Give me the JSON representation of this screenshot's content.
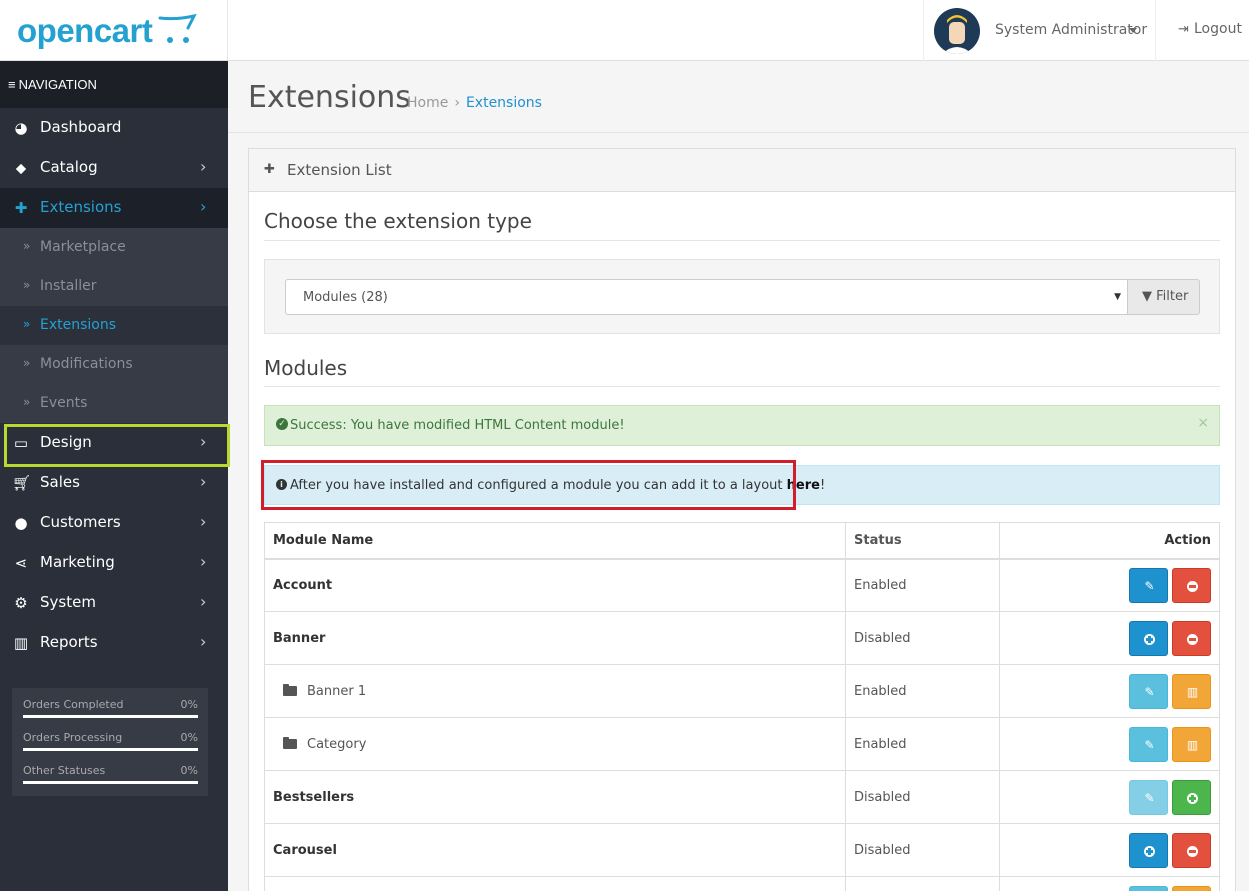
{
  "header": {
    "logo_text": "opencart",
    "user_name": "System Administrator",
    "logout_label": "Logout"
  },
  "sidebar": {
    "nav_header": "NAVIGATION",
    "items": [
      {
        "label": "Dashboard",
        "icon": "dashboard-icon"
      },
      {
        "label": "Catalog",
        "icon": "tags-icon"
      },
      {
        "label": "Extensions",
        "icon": "puzzle-icon",
        "active": true
      },
      {
        "label": "Design",
        "icon": "monitor-icon",
        "highlighted": true
      },
      {
        "label": "Sales",
        "icon": "cart-icon"
      },
      {
        "label": "Customers",
        "icon": "user-icon"
      },
      {
        "label": "Marketing",
        "icon": "share-icon"
      },
      {
        "label": "System",
        "icon": "gear-icon"
      },
      {
        "label": "Reports",
        "icon": "bar-chart-icon"
      }
    ],
    "extensions_sub": [
      {
        "label": "Marketplace"
      },
      {
        "label": "Installer"
      },
      {
        "label": "Extensions",
        "active": true
      },
      {
        "label": "Modifications"
      },
      {
        "label": "Events"
      }
    ],
    "stats": [
      {
        "label": "Orders Completed",
        "value": "0%",
        "fraction": 0
      },
      {
        "label": "Orders Processing",
        "value": "0%",
        "fraction": 0
      },
      {
        "label": "Other Statuses",
        "value": "0%",
        "fraction": 0
      }
    ]
  },
  "page": {
    "title": "Extensions",
    "breadcrumb": [
      "Home",
      "Extensions"
    ],
    "panel_title": "Extension List",
    "choose_heading": "Choose the extension type",
    "type_select_value": "Modules (28)",
    "filter_label": "Filter",
    "modules_heading": "Modules",
    "alert_success": "Success: You have modified HTML Content module!",
    "alert_info_text": "After you have installed and configured a module you can add it to a layout ",
    "alert_info_link": "here",
    "alert_info_end": "!"
  },
  "table": {
    "headers": [
      "Module Name",
      "Status",
      "Action"
    ],
    "rows": [
      {
        "name": "Account",
        "status": "Enabled",
        "child": false,
        "buttons": [
          "edit",
          "uninstall"
        ]
      },
      {
        "name": "Banner",
        "status": "Disabled",
        "child": false,
        "buttons": [
          "install",
          "uninstall"
        ]
      },
      {
        "name": "Banner 1",
        "status": "Enabled",
        "child": true,
        "buttons": [
          "edit-light",
          "delete"
        ]
      },
      {
        "name": "Category",
        "status": "Enabled",
        "child": true,
        "buttons": [
          "edit-light",
          "delete"
        ]
      },
      {
        "name": "Bestsellers",
        "status": "Disabled",
        "child": false,
        "buttons": [
          "edit-dim",
          "install-green"
        ]
      },
      {
        "name": "Carousel",
        "status": "Disabled",
        "child": false,
        "buttons": [
          "install",
          "uninstall"
        ]
      },
      {
        "name": "",
        "status": "",
        "child": false,
        "buttons": [
          "edit-light",
          "delete"
        ]
      }
    ]
  },
  "colors": {
    "brand": "#23a1d1",
    "sidebar_bg": "#2b2f3a",
    "highlight_box": "#b8d832",
    "annotation_box": "#d31d2a"
  }
}
